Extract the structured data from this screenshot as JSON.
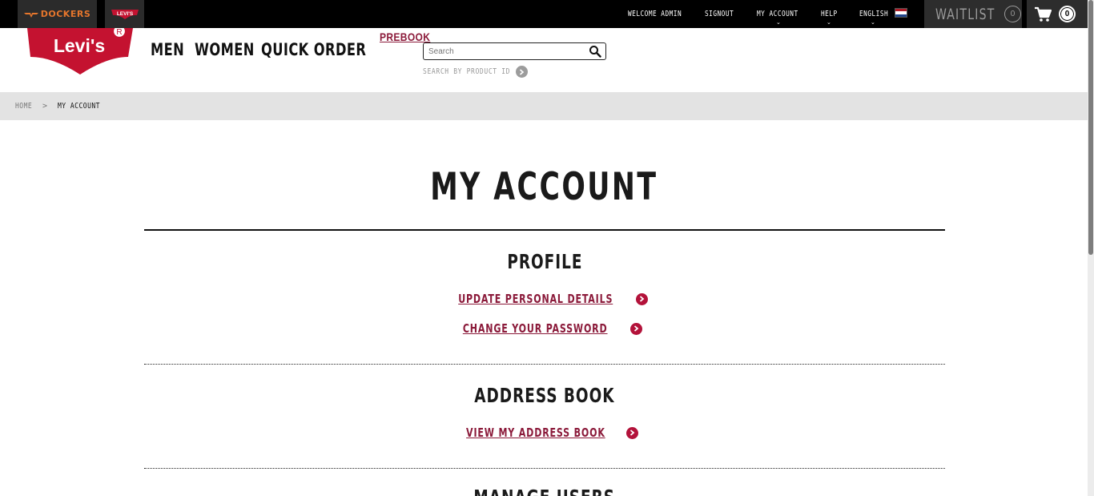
{
  "topbar": {
    "brand_dockers": "DOCKERS",
    "brand_levis": "LEVI'S",
    "welcome": "WELCOME ADMIN",
    "signout": "SIGNOUT",
    "my_account": "MY ACCOUNT",
    "help": "HELP",
    "language": "ENGLISH",
    "waitlist_label": "WAITLIST",
    "waitlist_count": "0",
    "cart_count": "0"
  },
  "header": {
    "logo_text": "Levi's",
    "nav": [
      "MEN",
      "WOMEN",
      "QUICK ORDER"
    ],
    "prebook": "PREBOOK",
    "search_placeholder": "Search",
    "search_by_id": "SEARCH BY PRODUCT ID"
  },
  "breadcrumb": {
    "home": "HOME",
    "separator": ">",
    "current": "MY ACCOUNT"
  },
  "page": {
    "title": "MY ACCOUNT",
    "sections": [
      {
        "title": "PROFILE",
        "links": [
          "UPDATE PERSONAL DETAILS",
          "CHANGE YOUR PASSWORD"
        ]
      },
      {
        "title": "ADDRESS BOOK",
        "links": [
          "VIEW MY ADDRESS BOOK"
        ]
      },
      {
        "title": "MANAGE USERS",
        "links": []
      }
    ]
  },
  "colors": {
    "brand_red": "#c41230",
    "link_maroon": "#8b1a3a",
    "dockers_orange": "#e6762c",
    "topbar_black": "#000000",
    "breadcrumb_grey": "#e3e3e3"
  },
  "icons": [
    "dockers-logo-icon",
    "levis-batwing-icon",
    "netherlands-flag-icon",
    "cart-icon",
    "search-icon",
    "chevron-right-icon"
  ]
}
